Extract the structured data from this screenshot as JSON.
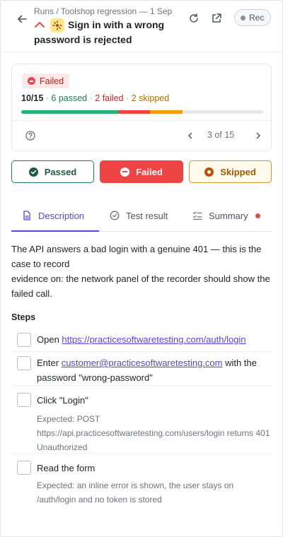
{
  "header": {
    "breadcrumb": "Runs / Toolshop regression — 1 Sep",
    "title": "Sign in with a wrong password is rejected",
    "record_label": "Rec"
  },
  "summary": {
    "status_badge": "Failed",
    "total": "10/15",
    "passed_label": "6 passed",
    "failed_label": "2 failed",
    "skipped_label": "2 skipped",
    "passed": 6,
    "failed": 2,
    "skipped": 2,
    "count": 15,
    "pager": "3 of 15"
  },
  "status_buttons": {
    "passed": "Passed",
    "failed": "Failed",
    "skipped": "Skipped"
  },
  "tabs": [
    {
      "label": "Description"
    },
    {
      "label": "Test result"
    },
    {
      "label": "Summary"
    }
  ],
  "description": {
    "line1": "The API answers a bad login with a genuine 401 — this is the case to record",
    "line2": "evidence on: the network panel of the recorder should show the failed call."
  },
  "steps": {
    "title": "Steps",
    "items": [
      {
        "prefix": "Open ",
        "link": "https://practicesoftwaretesting.com/auth/login"
      },
      {
        "prefix": "Enter ",
        "link": "customer@practicesoftwaretesting.com",
        "suffix": " with the password \"wrong-password\""
      },
      {
        "text": "Click \"Login\"",
        "expected": "Expected: POST https://api.practicesoftwaretesting.com/users/login returns 401 Unauthorized"
      },
      {
        "text": "Read the form",
        "expected": "Expected: an inline error is shown, the user stays on /auth/login and no token is stored"
      }
    ]
  },
  "colors": {
    "accent": "#4f46e5",
    "passed": "#22b573",
    "failed": "#ef4444",
    "skipped": "#f59e0b"
  }
}
